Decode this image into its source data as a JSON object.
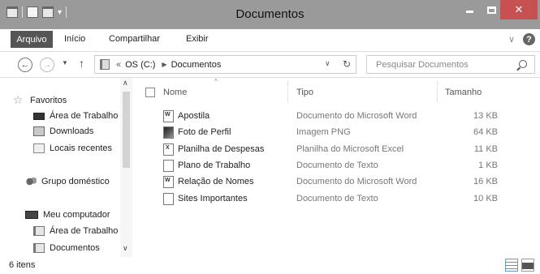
{
  "window": {
    "title": "Documentos",
    "close_glyph": "✕"
  },
  "ribbon": {
    "tabs": [
      {
        "label": "Arquivo",
        "active": true
      },
      {
        "label": "Início"
      },
      {
        "label": "Compartilhar"
      },
      {
        "label": "Exibir"
      }
    ],
    "help_glyph": "?"
  },
  "address": {
    "chevron": "«",
    "segments": [
      "OS (C:)",
      "Documentos"
    ],
    "separator": "▶"
  },
  "search": {
    "placeholder": "Pesquisar Documentos"
  },
  "navigation": {
    "items": [
      {
        "label": "Favoritos",
        "icon": "star-icon"
      },
      {
        "label": "Área de Trabalho",
        "icon": "desktop-icon"
      },
      {
        "label": "Downloads",
        "icon": "downloads-icon"
      },
      {
        "label": "Locais recentes",
        "icon": "recent-places-icon"
      },
      {
        "label": "Grupo doméstico",
        "icon": "homegroup-icon"
      },
      {
        "label": "Meu computador",
        "icon": "computer-icon"
      },
      {
        "label": "Área de Trabalho",
        "icon": "desktop-icon"
      },
      {
        "label": "Documentos",
        "icon": "documents-icon"
      }
    ]
  },
  "file_list": {
    "columns": [
      "Nome",
      "Tipo",
      "Tamanho"
    ],
    "sort_column": "Nome",
    "files": [
      {
        "name": "Apostila",
        "type": "Documento do Microsoft Word",
        "size": "13 KB",
        "icon": "word-document-icon"
      },
      {
        "name": "Foto de Perfil",
        "type": "Imagem PNG",
        "size": "64 KB",
        "icon": "image-file-icon"
      },
      {
        "name": "Planilha de Despesas",
        "type": "Planilha do Microsoft Excel",
        "size": "11 KB",
        "icon": "excel-spreadsheet-icon"
      },
      {
        "name": "Plano de Trabalho",
        "type": "Documento de Texto",
        "size": "1 KB",
        "icon": "text-document-icon"
      },
      {
        "name": "Relação de Nomes",
        "type": "Documento do Microsoft Word",
        "size": "16 KB",
        "icon": "word-document-icon"
      },
      {
        "name": "Sites Importantes",
        "type": "Documento de Texto",
        "size": "10 KB",
        "icon": "text-document-icon"
      }
    ]
  },
  "status": {
    "item_count": "6 itens"
  },
  "colors": {
    "titlebar": "#9a9a9a",
    "close_button": "#c75050",
    "active_tab": "#555555"
  }
}
